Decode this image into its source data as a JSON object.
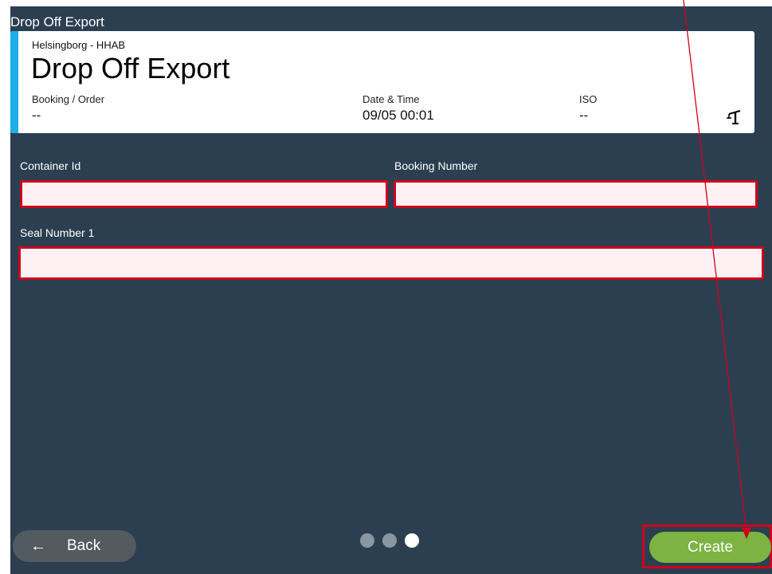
{
  "app": {
    "title": "Drop Off Export"
  },
  "header": {
    "terminal": "Helsingborg - HHAB",
    "title": "Drop Off Export",
    "booking_label": "Booking / Order",
    "booking_value": "--",
    "datetime_label": "Date & Time",
    "datetime_value": "09/05 00:01",
    "iso_label": "ISO",
    "iso_value": "--",
    "accent_color": "#1ab1e8",
    "icon": "crane-icon"
  },
  "form": {
    "container_id_label": "Container Id",
    "container_id_value": "",
    "booking_number_label": "Booking Number",
    "booking_number_value": "",
    "seal_number_label": "Seal Number 1",
    "seal_number_value": ""
  },
  "footer": {
    "back_label": "Back",
    "back_icon": "arrow-left-icon",
    "create_label": "Create",
    "pages_total": 3,
    "page_active": 3,
    "create_color": "#7cb342",
    "invalid_border_color": "#d0021b"
  }
}
